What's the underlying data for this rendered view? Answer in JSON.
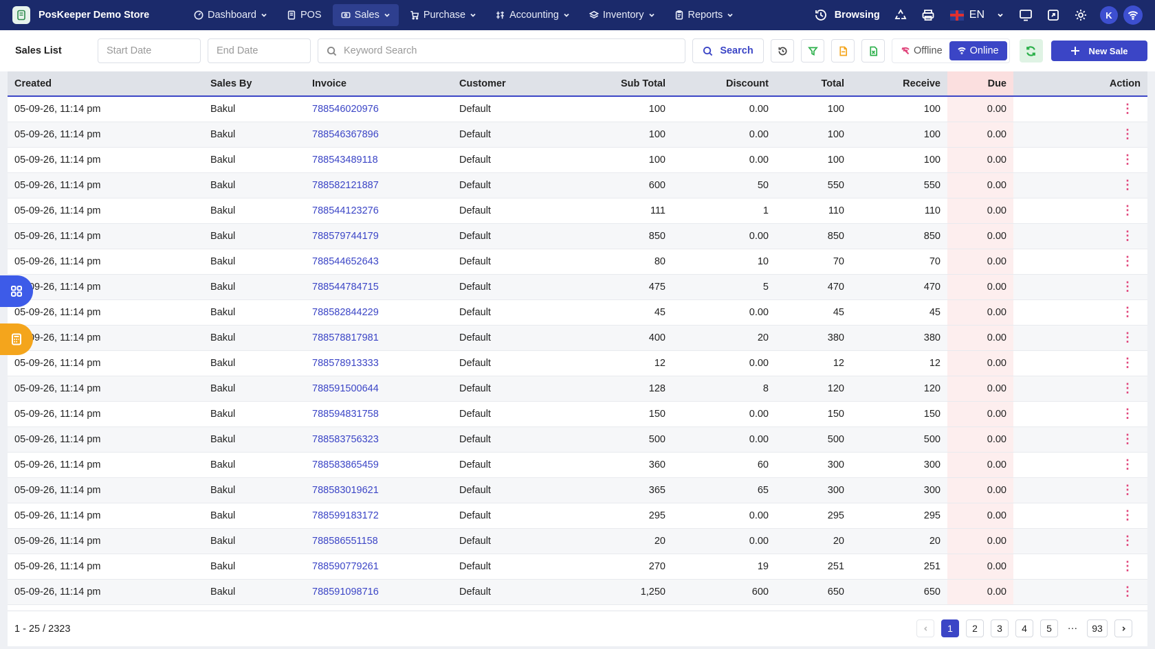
{
  "app": {
    "store_name": "PosKeeper Demo Store"
  },
  "nav": {
    "items": [
      {
        "label": "Dashboard",
        "icon": "dashboard-icon",
        "dropdown": true,
        "active": false
      },
      {
        "label": "POS",
        "icon": "pos-icon",
        "dropdown": false,
        "active": false
      },
      {
        "label": "Sales",
        "icon": "sales-icon",
        "dropdown": true,
        "active": true
      },
      {
        "label": "Purchase",
        "icon": "cart-icon",
        "dropdown": true,
        "active": false
      },
      {
        "label": "Accounting",
        "icon": "accounting-icon",
        "dropdown": true,
        "active": false
      },
      {
        "label": "Inventory",
        "icon": "inventory-icon",
        "dropdown": true,
        "active": false
      },
      {
        "label": "Reports",
        "icon": "reports-icon",
        "dropdown": true,
        "active": false
      }
    ],
    "browsing_label": "Browsing",
    "language": "EN",
    "avatar_initial": "K"
  },
  "toolbar": {
    "title": "Sales List",
    "start_date_placeholder": "Start Date",
    "end_date_placeholder": "End Date",
    "keyword_placeholder": "Keyword Search",
    "search_label": "Search",
    "offline_label": "Offline",
    "online_label": "Online",
    "new_sale_label": "New Sale"
  },
  "table": {
    "columns": [
      "Created",
      "Sales By",
      "Invoice",
      "Customer",
      "Sub Total",
      "Discount",
      "Total",
      "Receive",
      "Due",
      "Action"
    ],
    "rows": [
      [
        "05-09-26, 11:14 pm",
        "Bakul",
        "788546020976",
        "Default",
        "100",
        "0.00",
        "100",
        "100",
        "0.00"
      ],
      [
        "05-09-26, 11:14 pm",
        "Bakul",
        "788546367896",
        "Default",
        "100",
        "0.00",
        "100",
        "100",
        "0.00"
      ],
      [
        "05-09-26, 11:14 pm",
        "Bakul",
        "788543489118",
        "Default",
        "100",
        "0.00",
        "100",
        "100",
        "0.00"
      ],
      [
        "05-09-26, 11:14 pm",
        "Bakul",
        "788582121887",
        "Default",
        "600",
        "50",
        "550",
        "550",
        "0.00"
      ],
      [
        "05-09-26, 11:14 pm",
        "Bakul",
        "788544123276",
        "Default",
        "111",
        "1",
        "110",
        "110",
        "0.00"
      ],
      [
        "05-09-26, 11:14 pm",
        "Bakul",
        "788579744179",
        "Default",
        "850",
        "0.00",
        "850",
        "850",
        "0.00"
      ],
      [
        "05-09-26, 11:14 pm",
        "Bakul",
        "788544652643",
        "Default",
        "80",
        "10",
        "70",
        "70",
        "0.00"
      ],
      [
        "05-09-26, 11:14 pm",
        "Bakul",
        "788544784715",
        "Default",
        "475",
        "5",
        "470",
        "470",
        "0.00"
      ],
      [
        "05-09-26, 11:14 pm",
        "Bakul",
        "788582844229",
        "Default",
        "45",
        "0.00",
        "45",
        "45",
        "0.00"
      ],
      [
        "05-09-26, 11:14 pm",
        "Bakul",
        "788578817981",
        "Default",
        "400",
        "20",
        "380",
        "380",
        "0.00"
      ],
      [
        "05-09-26, 11:14 pm",
        "Bakul",
        "788578913333",
        "Default",
        "12",
        "0.00",
        "12",
        "12",
        "0.00"
      ],
      [
        "05-09-26, 11:14 pm",
        "Bakul",
        "788591500644",
        "Default",
        "128",
        "8",
        "120",
        "120",
        "0.00"
      ],
      [
        "05-09-26, 11:14 pm",
        "Bakul",
        "788594831758",
        "Default",
        "150",
        "0.00",
        "150",
        "150",
        "0.00"
      ],
      [
        "05-09-26, 11:14 pm",
        "Bakul",
        "788583756323",
        "Default",
        "500",
        "0.00",
        "500",
        "500",
        "0.00"
      ],
      [
        "05-09-26, 11:14 pm",
        "Bakul",
        "788583865459",
        "Default",
        "360",
        "60",
        "300",
        "300",
        "0.00"
      ],
      [
        "05-09-26, 11:14 pm",
        "Bakul",
        "788583019621",
        "Default",
        "365",
        "65",
        "300",
        "300",
        "0.00"
      ],
      [
        "05-09-26, 11:14 pm",
        "Bakul",
        "788599183172",
        "Default",
        "295",
        "0.00",
        "295",
        "295",
        "0.00"
      ],
      [
        "05-09-26, 11:14 pm",
        "Bakul",
        "788586551158",
        "Default",
        "20",
        "0.00",
        "20",
        "20",
        "0.00"
      ],
      [
        "05-09-26, 11:14 pm",
        "Bakul",
        "788590779261",
        "Default",
        "270",
        "19",
        "251",
        "251",
        "0.00"
      ],
      [
        "05-09-26, 11:14 pm",
        "Bakul",
        "788591098716",
        "Default",
        "1,250",
        "600",
        "650",
        "650",
        "0.00"
      ]
    ],
    "action_glyph": "⋮"
  },
  "footer": {
    "range": "1 - 25 / 2323",
    "pages": [
      "1",
      "2",
      "3",
      "4",
      "5"
    ],
    "current_page": "1",
    "ellipsis": "···",
    "last_page": "93"
  },
  "colors": {
    "nav_bg": "#1b2a6b",
    "accent": "#3b45c6",
    "due_bg": "#fbdfdf",
    "sync_green": "#2bb04a",
    "float_blue": "#3d5be8",
    "float_orange": "#f4a51c"
  }
}
